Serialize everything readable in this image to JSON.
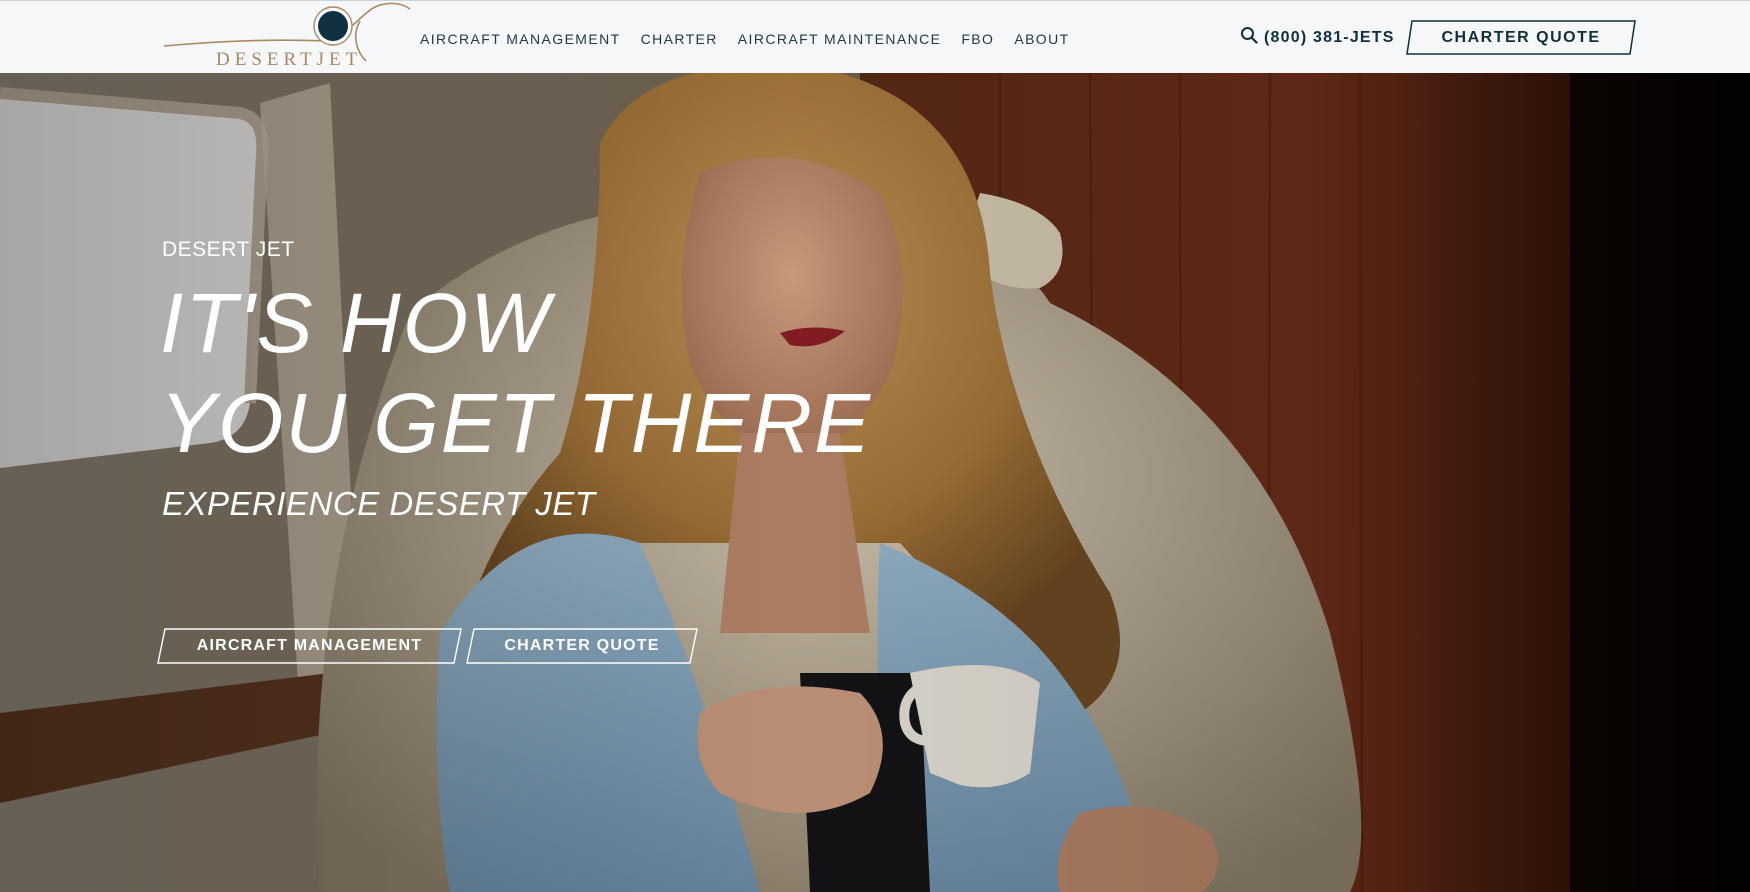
{
  "brand": {
    "logo_text": "DESERTJET",
    "logo_colors": {
      "tan": "#a98a62",
      "navy": "#0f3140"
    }
  },
  "nav": {
    "links": [
      {
        "label": "AIRCRAFT MANAGEMENT"
      },
      {
        "label": "CHARTER"
      },
      {
        "label": "AIRCRAFT MAINTENANCE"
      },
      {
        "label": "FBO"
      },
      {
        "label": "ABOUT"
      }
    ],
    "search_icon": "search-icon",
    "phone": "(800) 381-JETS",
    "quote_button": "CHARTER QUOTE"
  },
  "hero": {
    "eyebrow": "DESERT JET",
    "headline_line1": "IT'S HOW",
    "headline_line2": "YOU GET THERE",
    "subhead": "EXPERIENCE DESERT JET",
    "buttons": [
      {
        "label": "AIRCRAFT MANAGEMENT"
      },
      {
        "label": "CHARTER QUOTE"
      }
    ],
    "image": "woman-holding-coffee-cup-in-private-jet-cabin"
  },
  "colors": {
    "navbar_bg": "#f6f7f9",
    "nav_text": "#1e3846",
    "accent_dark": "#0f2f3b",
    "hero_text": "#ffffff"
  }
}
